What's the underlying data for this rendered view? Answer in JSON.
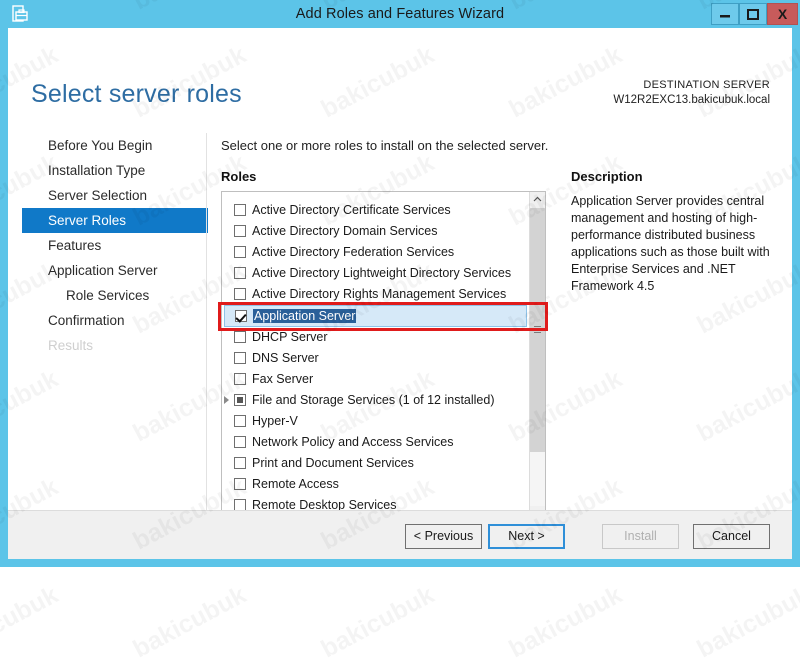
{
  "window": {
    "title": "Add Roles and Features Wizard",
    "icon": "server-roles-icon",
    "minimize_label": "–",
    "maximize_label": "□",
    "close_label": "X",
    "accent_color": "#5cc4e8",
    "close_color": "#c75b5b"
  },
  "header": {
    "page_title": "Select server roles",
    "destination_label": "DESTINATION SERVER",
    "destination_value": "W12R2EXC13.bakicubuk.local"
  },
  "sidebar": {
    "items": [
      {
        "label": "Before You Begin",
        "state": "normal",
        "sub": false
      },
      {
        "label": "Installation Type",
        "state": "normal",
        "sub": false
      },
      {
        "label": "Server Selection",
        "state": "normal",
        "sub": false
      },
      {
        "label": "Server Roles",
        "state": "active",
        "sub": false
      },
      {
        "label": "Features",
        "state": "normal",
        "sub": false
      },
      {
        "label": "Application Server",
        "state": "normal",
        "sub": false
      },
      {
        "label": "Role Services",
        "state": "normal",
        "sub": true
      },
      {
        "label": "Confirmation",
        "state": "normal",
        "sub": false
      },
      {
        "label": "Results",
        "state": "disabled",
        "sub": false
      }
    ],
    "active_color": "#1079c8"
  },
  "main": {
    "instruction": "Select one or more roles to install on the selected server.",
    "roles_label": "Roles",
    "roles": [
      {
        "label": "Active Directory Certificate Services",
        "checked": false,
        "partial": false,
        "selected": false,
        "expandable": false
      },
      {
        "label": "Active Directory Domain Services",
        "checked": false,
        "partial": false,
        "selected": false,
        "expandable": false
      },
      {
        "label": "Active Directory Federation Services",
        "checked": false,
        "partial": false,
        "selected": false,
        "expandable": false
      },
      {
        "label": "Active Directory Lightweight Directory Services",
        "checked": false,
        "partial": false,
        "selected": false,
        "expandable": false
      },
      {
        "label": "Active Directory Rights Management Services",
        "checked": false,
        "partial": false,
        "selected": false,
        "expandable": false
      },
      {
        "label": "Application Server",
        "checked": true,
        "partial": false,
        "selected": true,
        "expandable": false
      },
      {
        "label": "DHCP Server",
        "checked": false,
        "partial": false,
        "selected": false,
        "expandable": false
      },
      {
        "label": "DNS Server",
        "checked": false,
        "partial": false,
        "selected": false,
        "expandable": false
      },
      {
        "label": "Fax Server",
        "checked": false,
        "partial": false,
        "selected": false,
        "expandable": false
      },
      {
        "label": "File and Storage Services (1 of 12 installed)",
        "checked": false,
        "partial": true,
        "selected": false,
        "expandable": true
      },
      {
        "label": "Hyper-V",
        "checked": false,
        "partial": false,
        "selected": false,
        "expandable": false
      },
      {
        "label": "Network Policy and Access Services",
        "checked": false,
        "partial": false,
        "selected": false,
        "expandable": false
      },
      {
        "label": "Print and Document Services",
        "checked": false,
        "partial": false,
        "selected": false,
        "expandable": false
      },
      {
        "label": "Remote Access",
        "checked": false,
        "partial": false,
        "selected": false,
        "expandable": false
      },
      {
        "label": "Remote Desktop Services",
        "checked": false,
        "partial": false,
        "selected": false,
        "expandable": false
      }
    ],
    "selection_highlight_color": "#2a6099",
    "annotation_box_color": "#e01b1b"
  },
  "description": {
    "title": "Description",
    "text": "Application Server provides central management and hosting of high-performance distributed business applications such as those built with Enterprise Services and .NET Framework 4.5"
  },
  "footer": {
    "previous_label": "< Previous",
    "next_label": "Next >",
    "install_label": "Install",
    "cancel_label": "Cancel",
    "install_enabled": false,
    "next_focused": true
  },
  "watermark": {
    "text": "bakicubuk"
  }
}
